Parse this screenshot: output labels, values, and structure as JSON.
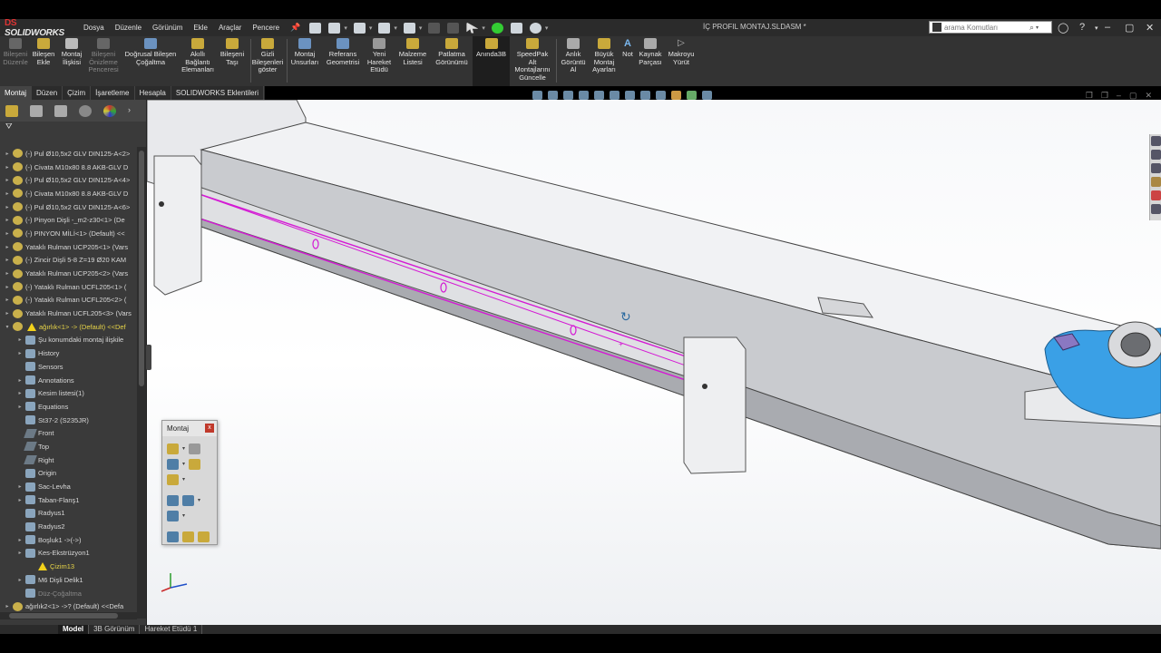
{
  "app": {
    "name": "SOLIDWORKS",
    "document_title": "İÇ PROFIL MONTAJ.SLDASM *"
  },
  "menu": [
    "Dosya",
    "Düzenle",
    "Görünüm",
    "Ekle",
    "Araçlar",
    "Pencere"
  ],
  "search": {
    "placeholder": "arama Komutları"
  },
  "command_manager": [
    {
      "label": "Bileşeni\nDüzenle",
      "enabled": false
    },
    {
      "label": "Bileşen\nEkle",
      "enabled": true
    },
    {
      "label": "Montaj\nİlişkisi",
      "enabled": true
    },
    {
      "label": "Bileşeni\nÖnizleme\nPenceresi",
      "enabled": false
    },
    {
      "label": "Doğrusal Bileşen\nÇoğaltma",
      "enabled": true
    },
    {
      "label": "Akıllı\nBağlantı\nElemanları",
      "enabled": true
    },
    {
      "label": "Bileşeni\nTaşı",
      "enabled": true
    },
    {
      "label": "Gizli\nBileşenleri\ngöster",
      "enabled": true
    },
    {
      "label": "Montaj\nUnsurları",
      "enabled": true
    },
    {
      "label": "Referans\nGeometrisi",
      "enabled": true
    },
    {
      "label": "Yeni\nHareket\nEtüdü",
      "enabled": true
    },
    {
      "label": "Malzeme\nListesi",
      "enabled": true
    },
    {
      "label": "Patlatma\nGörünümü",
      "enabled": true
    },
    {
      "label": "Anında3B",
      "enabled": true
    },
    {
      "label": "SpeedPak\nAlt\nMontajlarını\nGüncelle",
      "enabled": true
    },
    {
      "label": "Anlık\nGörüntü\nAl",
      "enabled": true
    },
    {
      "label": "Büyük\nMontaj\nAyarları",
      "enabled": true
    },
    {
      "label": "Not",
      "enabled": true
    },
    {
      "label": "Kaynak\nParçası",
      "enabled": true
    },
    {
      "label": "Makroyu\nYürüt",
      "enabled": true
    }
  ],
  "tabs": [
    {
      "label": "Montaj",
      "selected": true
    },
    {
      "label": "Düzen",
      "selected": false
    },
    {
      "label": "Çizim",
      "selected": false
    },
    {
      "label": "İşaretleme",
      "selected": false
    },
    {
      "label": "Hesapla",
      "selected": false
    },
    {
      "label": "SOLIDWORKS Eklentileri",
      "selected": false
    }
  ],
  "feature_tree": [
    {
      "text": "(-) Pul Ø10,5x2 GLV DIN125-A<2>",
      "icon": "comp",
      "style": "normal",
      "indent": 0,
      "caret": "▸"
    },
    {
      "text": "(-) Civata M10x80 8.8 AKB-GLV D",
      "icon": "comp",
      "style": "normal",
      "indent": 0,
      "caret": "▸"
    },
    {
      "text": "(-) Pul Ø10,5x2 GLV DIN125-A<4>",
      "icon": "comp",
      "style": "normal",
      "indent": 0,
      "caret": "▸"
    },
    {
      "text": "(-) Civata M10x80 8.8 AKB-GLV D",
      "icon": "comp",
      "style": "normal",
      "indent": 0,
      "caret": "▸"
    },
    {
      "text": "(-) Pul Ø10,5x2 GLV DIN125-A<6>",
      "icon": "comp",
      "style": "normal",
      "indent": 0,
      "caret": "▸"
    },
    {
      "text": "(-) Pinyon Dişli -_m2-z30<1> (De",
      "icon": "comp",
      "style": "normal",
      "indent": 0,
      "caret": "▸"
    },
    {
      "text": "(-) PINYON MİLİ<1> (Default) <<",
      "icon": "comp",
      "style": "normal",
      "indent": 0,
      "caret": "▸"
    },
    {
      "text": "Yataklı Rulman UCP205<1> (Vars",
      "icon": "comp",
      "style": "normal",
      "indent": 0,
      "caret": "▸"
    },
    {
      "text": "(-) Zincir Dişli 5-8 Z=19 Ø20 KAM",
      "icon": "comp",
      "style": "normal",
      "indent": 0,
      "caret": "▸"
    },
    {
      "text": "Yataklı Rulman UCP205<2> (Vars",
      "icon": "comp",
      "style": "normal",
      "indent": 0,
      "caret": "▸"
    },
    {
      "text": "(-) Yataklı Rulman UCFL205<1> (",
      "icon": "comp",
      "style": "normal",
      "indent": 0,
      "caret": "▸"
    },
    {
      "text": "(-) Yataklı Rulman UCFL205<2> (",
      "icon": "comp",
      "style": "normal",
      "indent": 0,
      "caret": "▸"
    },
    {
      "text": "Yataklı Rulman UCFL205<3> (Vars",
      "icon": "comp",
      "style": "normal",
      "indent": 0,
      "caret": "▸"
    },
    {
      "text": "ağırlık<1> -> (Default) <<Def",
      "icon": "comp",
      "style": "yellow",
      "indent": 0,
      "caret": "▾",
      "warn": true
    },
    {
      "text": "Şu konumdaki montaj ilişkile",
      "icon": "feat",
      "style": "normal",
      "indent": 1,
      "caret": "▸"
    },
    {
      "text": "History",
      "icon": "feat",
      "style": "normal",
      "indent": 1,
      "caret": "▸"
    },
    {
      "text": "Sensors",
      "icon": "feat",
      "style": "normal",
      "indent": 1,
      "caret": ""
    },
    {
      "text": "Annotations",
      "icon": "feat",
      "style": "normal",
      "indent": 1,
      "caret": "▸"
    },
    {
      "text": "Kesim listesi(1)",
      "icon": "feat",
      "style": "normal",
      "indent": 1,
      "caret": "▸"
    },
    {
      "text": "Equations",
      "icon": "feat",
      "style": "normal",
      "indent": 1,
      "caret": "▸"
    },
    {
      "text": "St37-2 (S235JR)",
      "icon": "feat",
      "style": "normal",
      "indent": 1,
      "caret": ""
    },
    {
      "text": "Front",
      "icon": "plane",
      "style": "normal",
      "indent": 1,
      "caret": ""
    },
    {
      "text": "Top",
      "icon": "plane",
      "style": "normal",
      "indent": 1,
      "caret": ""
    },
    {
      "text": "Right",
      "icon": "plane",
      "style": "normal",
      "indent": 1,
      "caret": ""
    },
    {
      "text": "Origin",
      "icon": "feat",
      "style": "normal",
      "indent": 1,
      "caret": ""
    },
    {
      "text": "Sac-Levha",
      "icon": "feat",
      "style": "normal",
      "indent": 1,
      "caret": "▸"
    },
    {
      "text": "Taban-Flanş1",
      "icon": "feat",
      "style": "normal",
      "indent": 1,
      "caret": "▸"
    },
    {
      "text": "Radyus1",
      "icon": "feat",
      "style": "normal",
      "indent": 1,
      "caret": ""
    },
    {
      "text": "Radyus2",
      "icon": "feat",
      "style": "normal",
      "indent": 1,
      "caret": ""
    },
    {
      "text": "Boşluk1 ->(->)",
      "icon": "feat",
      "style": "normal",
      "indent": 1,
      "caret": "▸"
    },
    {
      "text": "Kes-Ekstrüzyon1",
      "icon": "feat",
      "style": "normal",
      "indent": 1,
      "caret": "▸"
    },
    {
      "text": "Çizim13",
      "icon": "warn",
      "style": "yellow",
      "indent": 2,
      "caret": ""
    },
    {
      "text": "M6 Dişli Delik1",
      "icon": "feat",
      "style": "normal",
      "indent": 1,
      "caret": "▸"
    },
    {
      "text": "Düz-Çoğaltma",
      "icon": "feat",
      "style": "dim",
      "indent": 1,
      "caret": ""
    },
    {
      "text": "ağırlık2<1> ->? (Default) <<Defa",
      "icon": "comp",
      "style": "normal",
      "indent": 0,
      "caret": "▸"
    }
  ],
  "floating_toolbar": {
    "title": "Montaj"
  },
  "bottom_tabs": [
    {
      "label": "Model",
      "selected": true
    },
    {
      "label": "3B Görünüm",
      "selected": false
    },
    {
      "label": "Hareket Etüdü 1",
      "selected": false
    }
  ],
  "colors": {
    "accent_blue": "#2f8fdc",
    "selection_magenta": "#d41ad4",
    "warning_yellow": "#f2d11b",
    "part_blue": "#3aa0e6"
  }
}
